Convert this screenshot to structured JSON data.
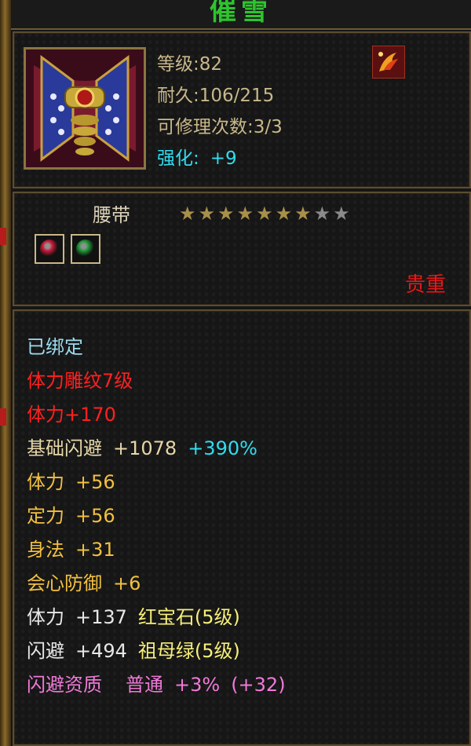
{
  "item": {
    "name": "催雪",
    "level": "等级:82",
    "durability": "耐久:106/215",
    "repairs": "可修理次数:3/3",
    "enhance_label": "强化:",
    "enhance_value": "+9",
    "type": "腰带",
    "stars_total": 9,
    "stars_lit": 7,
    "rarity": "贵重"
  },
  "gem_slots": [
    {
      "name": "red-gem",
      "color": "#d11a3a"
    },
    {
      "name": "green-gem",
      "color": "#1f9e3a"
    }
  ],
  "attributes": {
    "bound": "已绑定",
    "engrave": "体力雕纹7级",
    "engrave_bonus": "体力+170",
    "base_dodge_label": "基础闪避",
    "base_dodge_value": "+1078",
    "base_dodge_percent": "+390%",
    "stat1_label": "体力",
    "stat1_value": "+56",
    "stat2_label": "定力",
    "stat2_value": "+56",
    "stat3_label": "身法",
    "stat3_value": "+31",
    "stat4_label": "会心防御",
    "stat4_value": "+6",
    "gem1_label": "体力",
    "gem1_value": "+137",
    "gem1_name": "红宝石(5级)",
    "gem2_label": "闪避",
    "gem2_value": "+494",
    "gem2_name": "祖母绿(5级)",
    "aptitude_label": "闪避资质",
    "aptitude_grade": "普通",
    "aptitude_value": "+3%",
    "aptitude_bonus": "(+32)"
  },
  "colors": {
    "title": "#2ec42e",
    "enhance": "#31dcf0",
    "rarity": "#e81818",
    "border": "#5c4c30"
  }
}
